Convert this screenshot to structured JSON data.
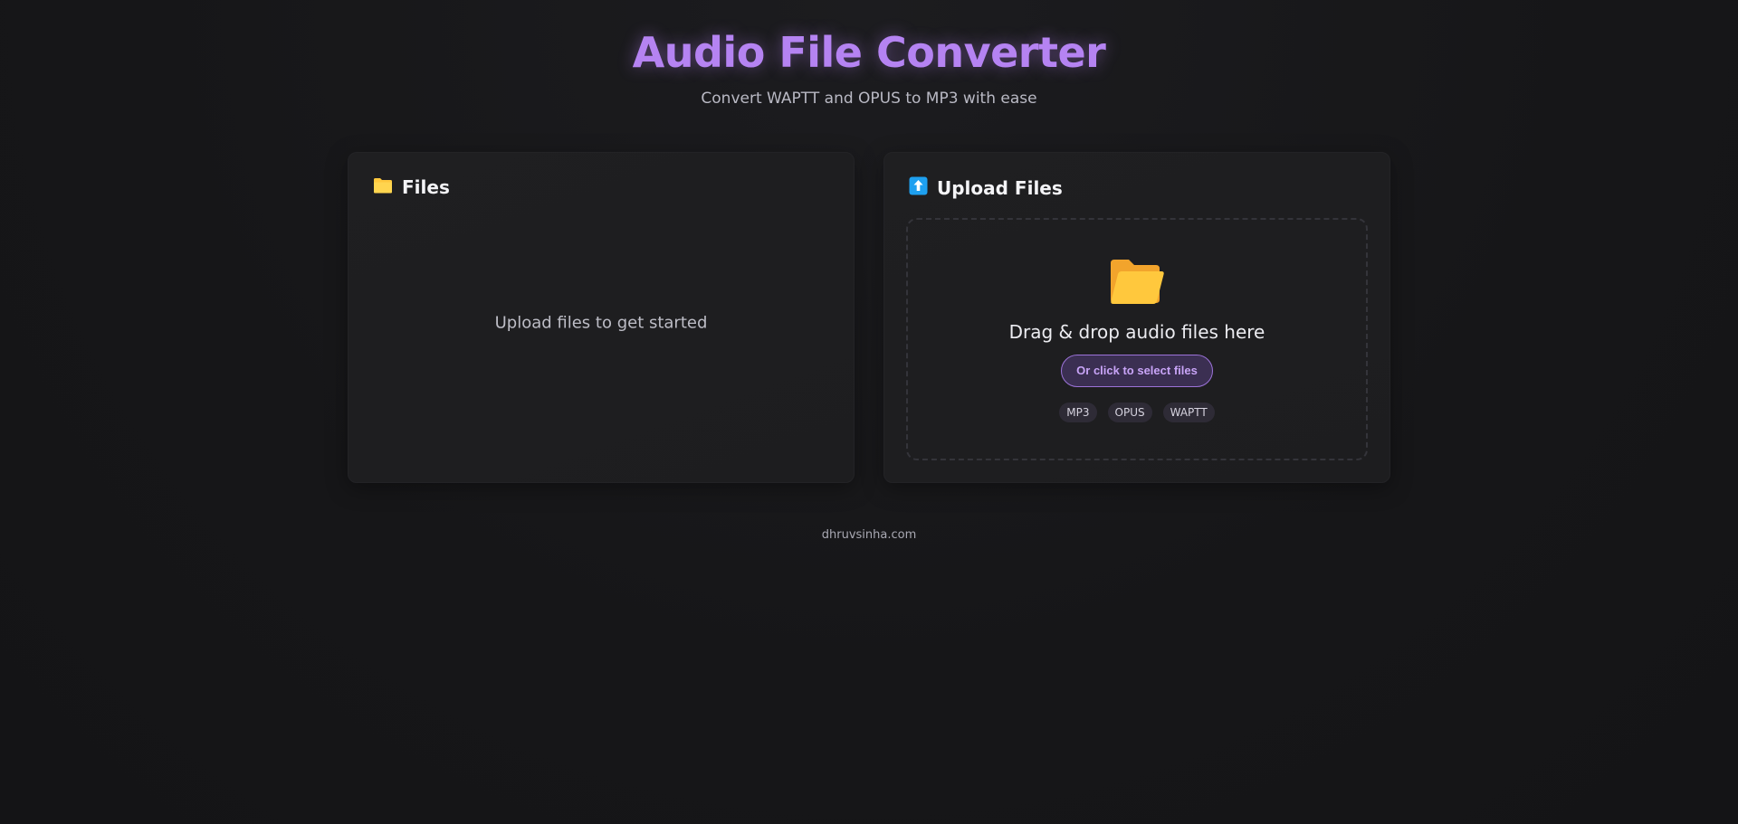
{
  "header": {
    "title": "Audio File Converter",
    "subtitle": "Convert WAPTT and OPUS to MP3 with ease"
  },
  "files_panel": {
    "icon": "folder-icon",
    "title": "Files",
    "empty_text": "Upload files to get started"
  },
  "upload_panel": {
    "icon": "upload-arrow-icon",
    "title": "Upload Files",
    "drop_icon": "open-folder-icon",
    "drop_text": "Drag & drop audio files here",
    "select_button": "Or click to select files",
    "formats": [
      "MP3",
      "OPUS",
      "WAPTT"
    ]
  },
  "footer": {
    "link_text": "dhruvsinha.com"
  },
  "colors": {
    "accent": "#b583f2",
    "folder": "#ffc83d",
    "upload_icon": "#1ea0f0",
    "background": "#161618",
    "panel": "#1e1e20"
  }
}
